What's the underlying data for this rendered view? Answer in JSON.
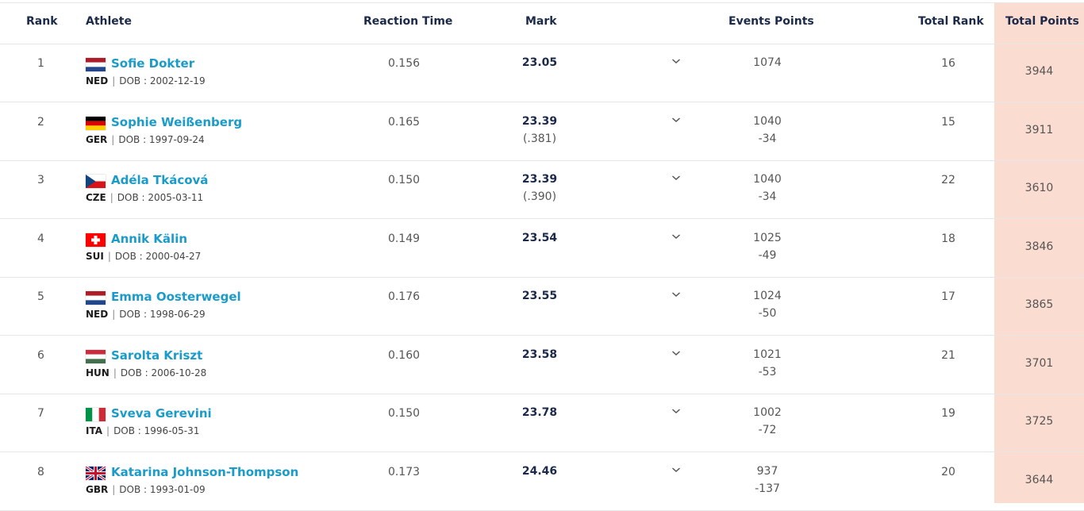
{
  "header": {
    "rank": "Rank",
    "athlete": "Athlete",
    "reaction_time": "Reaction Time",
    "mark": "Mark",
    "events_points": "Events Points",
    "total_rank": "Total Rank",
    "total_points": "Total Points"
  },
  "colors": {
    "total_points_bg": "#fbdcd1",
    "athlete_link": "#1a9bc9",
    "header_text": "#1b2a4a"
  },
  "rows": [
    {
      "rank": "1",
      "name": "Sofie Dokter",
      "nat": "NED",
      "dob": "DOB : 2002-12-19",
      "reaction": "0.156",
      "mark": "23.05",
      "mark_wind": "",
      "events_points": "1074",
      "events_diff": "",
      "total_rank": "16",
      "total_points": "3944",
      "flag": "NED"
    },
    {
      "rank": "2",
      "name": "Sophie Weißenberg",
      "nat": "GER",
      "dob": "DOB : 1997-09-24",
      "reaction": "0.165",
      "mark": "23.39",
      "mark_wind": "(.381)",
      "events_points": "1040",
      "events_diff": "-34",
      "total_rank": "15",
      "total_points": "3911",
      "flag": "GER"
    },
    {
      "rank": "3",
      "name": "Adéla Tkácová",
      "nat": "CZE",
      "dob": "DOB : 2005-03-11",
      "reaction": "0.150",
      "mark": "23.39",
      "mark_wind": "(.390)",
      "events_points": "1040",
      "events_diff": "-34",
      "total_rank": "22",
      "total_points": "3610",
      "flag": "CZE"
    },
    {
      "rank": "4",
      "name": "Annik Kälin",
      "nat": "SUI",
      "dob": "DOB : 2000-04-27",
      "reaction": "0.149",
      "mark": "23.54",
      "mark_wind": "",
      "events_points": "1025",
      "events_diff": "-49",
      "total_rank": "18",
      "total_points": "3846",
      "flag": "SUI"
    },
    {
      "rank": "5",
      "name": "Emma Oosterwegel",
      "nat": "NED",
      "dob": "DOB : 1998-06-29",
      "reaction": "0.176",
      "mark": "23.55",
      "mark_wind": "",
      "events_points": "1024",
      "events_diff": "-50",
      "total_rank": "17",
      "total_points": "3865",
      "flag": "NED"
    },
    {
      "rank": "6",
      "name": "Sarolta Kriszt",
      "nat": "HUN",
      "dob": "DOB : 2006-10-28",
      "reaction": "0.160",
      "mark": "23.58",
      "mark_wind": "",
      "events_points": "1021",
      "events_diff": "-53",
      "total_rank": "21",
      "total_points": "3701",
      "flag": "HUN"
    },
    {
      "rank": "7",
      "name": "Sveva Gerevini",
      "nat": "ITA",
      "dob": "DOB : 1996-05-31",
      "reaction": "0.150",
      "mark": "23.78",
      "mark_wind": "",
      "events_points": "1002",
      "events_diff": "-72",
      "total_rank": "19",
      "total_points": "3725",
      "flag": "ITA"
    },
    {
      "rank": "8",
      "name": "Katarina Johnson-Thompson",
      "nat": "GBR",
      "dob": "DOB : 1993-01-09",
      "reaction": "0.173",
      "mark": "24.46",
      "mark_wind": "",
      "events_points": "937",
      "events_diff": "-137",
      "total_rank": "20",
      "total_points": "3644",
      "flag": "GBR"
    }
  ]
}
